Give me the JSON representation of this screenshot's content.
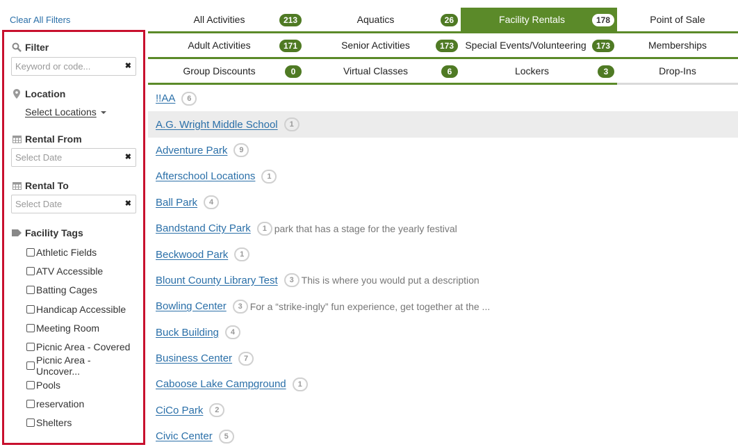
{
  "clear_filters": "Clear All Filters",
  "colors": {
    "accent_green": "#5b8a29",
    "highlight_border": "#c8102e",
    "link_blue": "#2a6fa8"
  },
  "sidebar": {
    "filter": {
      "label": "Filter",
      "icon": "search-icon",
      "placeholder": "Keyword or code..."
    },
    "location": {
      "label": "Location",
      "icon": "map-pin-icon",
      "select_label": "Select Locations"
    },
    "rental_from": {
      "label": "Rental From",
      "icon": "calendar-icon",
      "placeholder": "Select Date"
    },
    "rental_to": {
      "label": "Rental To",
      "icon": "calendar-icon",
      "placeholder": "Select Date"
    },
    "facility_tags": {
      "label": "Facility Tags",
      "icon": "tag-icon",
      "items": [
        "Athletic Fields",
        "ATV Accessible",
        "Batting Cages",
        "Handicap Accessible",
        "Meeting Room",
        "Picnic Area - Covered",
        "Picnic Area - Uncover...",
        "Pools",
        "reservation",
        "Shelters"
      ]
    }
  },
  "tabs": [
    [
      {
        "label": "All Activities",
        "count": "213"
      },
      {
        "label": "Aquatics",
        "count": "26"
      },
      {
        "label": "Facility Rentals",
        "count": "178",
        "active": true
      },
      {
        "label": "Point of Sale",
        "count": ""
      }
    ],
    [
      {
        "label": "Adult Activities",
        "count": "171"
      },
      {
        "label": "Senior Activities",
        "count": "173"
      },
      {
        "label": "Special Events/Volunteering",
        "count": "173"
      },
      {
        "label": "Memberships",
        "count": ""
      }
    ],
    [
      {
        "label": "Group Discounts",
        "count": "0"
      },
      {
        "label": "Virtual Classes",
        "count": "6"
      },
      {
        "label": "Lockers",
        "count": "3"
      },
      {
        "label": "Drop-Ins",
        "count": ""
      }
    ]
  ],
  "facilities": [
    {
      "name": "!!AA",
      "count": "6",
      "desc": ""
    },
    {
      "name": "A.G. Wright Middle School",
      "count": "1",
      "desc": ""
    },
    {
      "name": "Adventure Park",
      "count": "9",
      "desc": ""
    },
    {
      "name": "Afterschool Locations",
      "count": "1",
      "desc": ""
    },
    {
      "name": "Ball Park",
      "count": "4",
      "desc": ""
    },
    {
      "name": "Bandstand City Park",
      "count": "1",
      "desc": "park that has a stage for the yearly festival"
    },
    {
      "name": "Beckwood Park",
      "count": "1",
      "desc": ""
    },
    {
      "name": "Blount County Library Test",
      "count": "3",
      "desc": "This is where you would put a description"
    },
    {
      "name": "Bowling Center",
      "count": "3",
      "desc": "For a “strike-ingly” fun experience, get together at the ..."
    },
    {
      "name": "Buck Building",
      "count": "4",
      "desc": ""
    },
    {
      "name": "Business Center",
      "count": "7",
      "desc": ""
    },
    {
      "name": "Caboose Lake Campground",
      "count": "1",
      "desc": ""
    },
    {
      "name": "CiCo Park",
      "count": "2",
      "desc": ""
    },
    {
      "name": "Civic Center",
      "count": "5",
      "desc": ""
    }
  ]
}
